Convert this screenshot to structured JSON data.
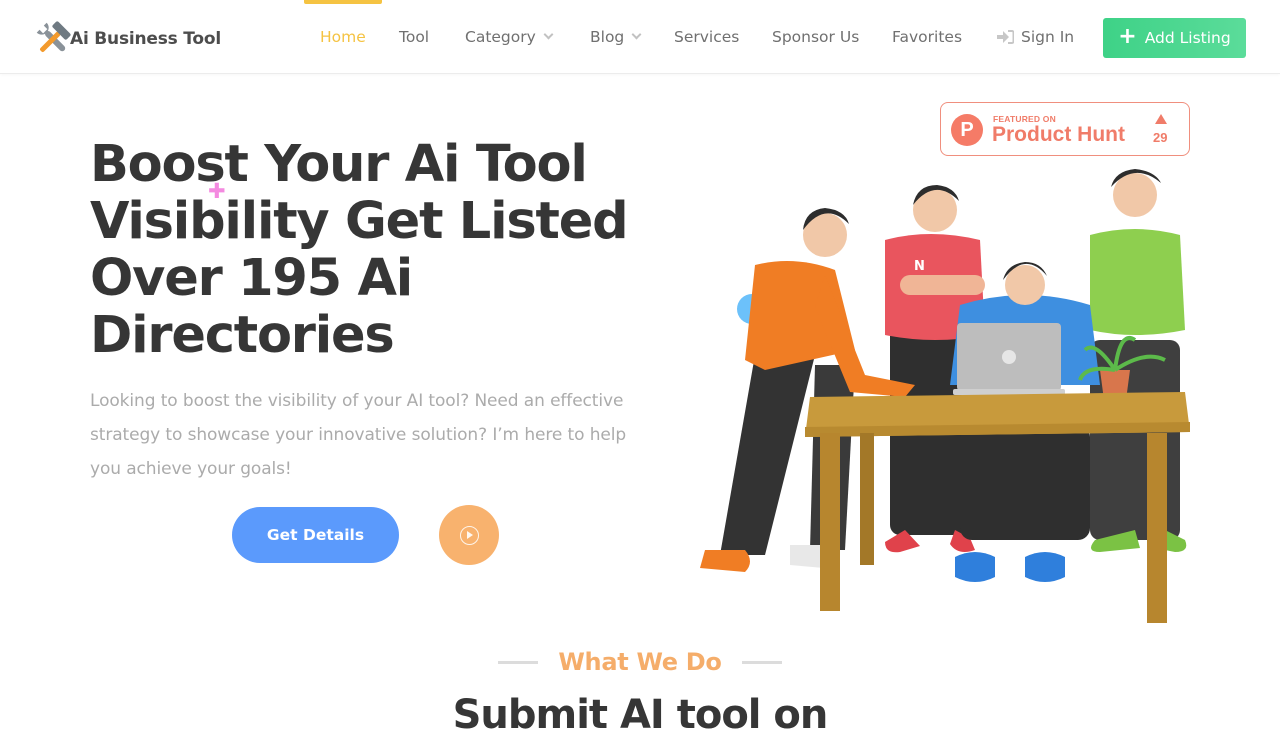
{
  "header": {
    "logo_text": "Ai Business Tool",
    "nav": [
      {
        "label": "Home",
        "active": true
      },
      {
        "label": "Tool"
      },
      {
        "label": "Category",
        "has_dropdown": true
      },
      {
        "label": "Blog",
        "has_dropdown": true
      },
      {
        "label": "Services"
      },
      {
        "label": "Sponsor Us"
      },
      {
        "label": "Favorites"
      }
    ],
    "sign_in_label": "Sign In",
    "add_listing_label": "Add Listing"
  },
  "product_hunt": {
    "logo_letter": "P",
    "featured_label": "FEATURED ON",
    "name": "Product Hunt",
    "upvotes": "29"
  },
  "hero": {
    "title_lines": [
      "Boost Your Ai Tool",
      "Visibility Get Listed",
      "Over 195 Ai",
      "Directories"
    ],
    "description": "Looking to boost the visibility of your AI tool? Need an effective strategy to showcase your innovative solution? I’m here to help you achieve your goals!",
    "cta_label": "Get Details",
    "decor_plus": "✚"
  },
  "section": {
    "label": "What We Do",
    "title": "Submit AI tool on"
  },
  "colors": {
    "accent_yellow": "#f5c342",
    "green_button": "#3ed287",
    "blue_button": "#5b9afc",
    "orange_play": "#f8b26e",
    "product_hunt": "#f07c69",
    "section_label": "#f5ad6a"
  }
}
